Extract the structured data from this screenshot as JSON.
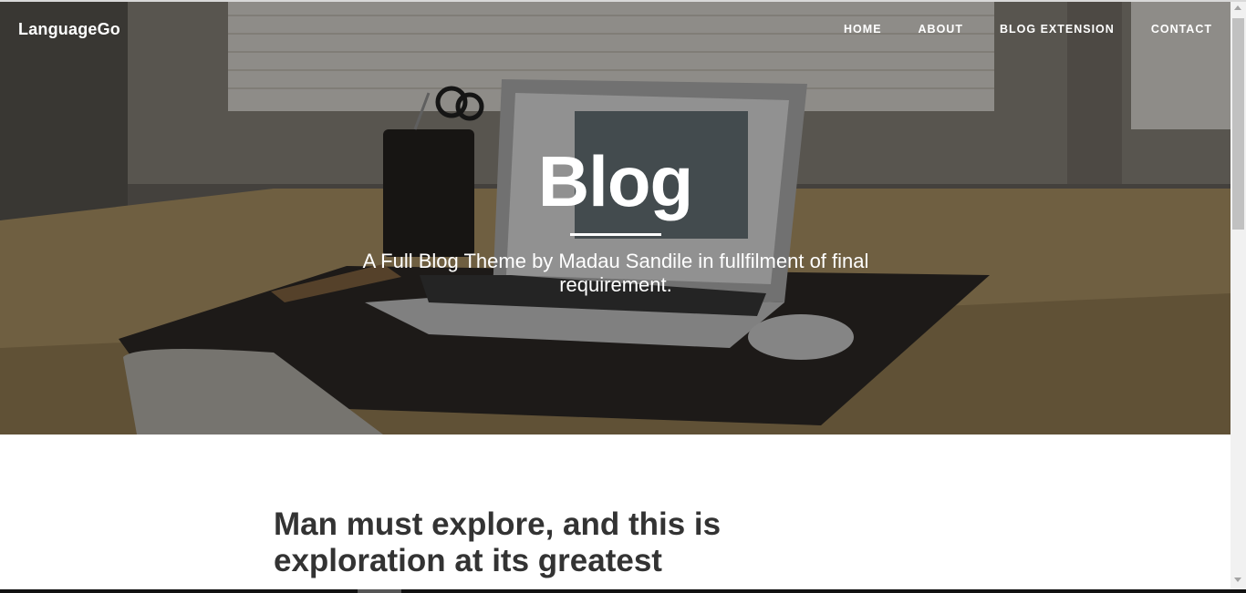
{
  "brand": "LanguageGo",
  "nav": [
    "HOME",
    "ABOUT",
    "BLOG EXTENSION",
    "CONTACT"
  ],
  "hero": {
    "title": "Blog",
    "subtitle": "A Full Blog Theme by Madau Sandile in fullfilment of final requirement."
  },
  "post": {
    "title": "Man must explore, and this is exploration at its greatest"
  },
  "colors": {
    "overlay": "#000000",
    "heading_text": "#333333",
    "hero_text": "#ffffff"
  },
  "icons": [
    "scroll-up-arrow-icon",
    "scroll-down-arrow-icon"
  ]
}
